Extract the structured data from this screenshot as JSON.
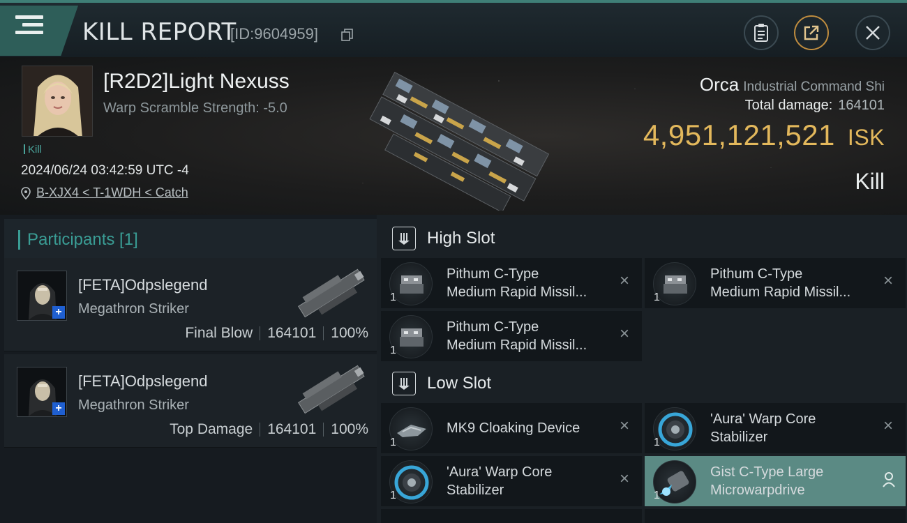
{
  "header": {
    "title": "KILL REPORT",
    "report_id": "[ID:9604959]"
  },
  "victim": {
    "name": "[R2D2]Light Nexuss",
    "warp_scramble": "Warp Scramble Strength: -5.0",
    "tag": "Kill",
    "time": "2024/06/24 03:42:59 UTC -4",
    "location": "B-XJX4 < T-1WDH < Catch",
    "ship_name": "Orca",
    "ship_class": "Industrial Command Shi",
    "total_damage_label": "Total damage:",
    "total_damage_value": "164101",
    "isk_value": "4,951,121,521",
    "isk_unit": "ISK",
    "result": "Kill"
  },
  "participants": {
    "title": "Participants [1]",
    "rows": [
      {
        "name": "[FETA]Odpslegend",
        "ship": "Megathron Striker",
        "role": "Final Blow",
        "damage": "164101",
        "percent": "100%"
      },
      {
        "name": "[FETA]Odpslegend",
        "ship": "Megathron Striker",
        "role": "Top Damage",
        "damage": "164101",
        "percent": "100%"
      }
    ]
  },
  "fitting": {
    "high_slot_title": "High Slot",
    "low_slot_title": "Low Slot",
    "high": [
      {
        "line1": "Pithum C-Type",
        "line2": "Medium Rapid Missil...",
        "qty": "1"
      },
      {
        "line1": "Pithum C-Type",
        "line2": "Medium Rapid Missil...",
        "qty": "1"
      },
      {
        "line1": "Pithum C-Type",
        "line2": "Medium Rapid Missil...",
        "qty": "1"
      }
    ],
    "low": [
      {
        "line1": "MK9 Cloaking Device",
        "line2": "",
        "qty": "1"
      },
      {
        "line1": "'Aura' Warp Core",
        "line2": "Stabilizer",
        "qty": "1"
      },
      {
        "line1": "'Aura' Warp Core",
        "line2": "Stabilizer",
        "qty": "1"
      },
      {
        "line1": "Gist C-Type Large",
        "line2": "Microwarpdrive",
        "qty": "1"
      }
    ]
  },
  "colors": {
    "accent": "#3a9d95",
    "isk": "#e3b85c",
    "highlight_row": "#5b8a84"
  },
  "icons": [
    "menu-icon",
    "copy-icon",
    "clipboard-icon",
    "share-icon",
    "close-icon",
    "location-pin-icon",
    "slot-icon",
    "remove-icon",
    "user-icon"
  ]
}
